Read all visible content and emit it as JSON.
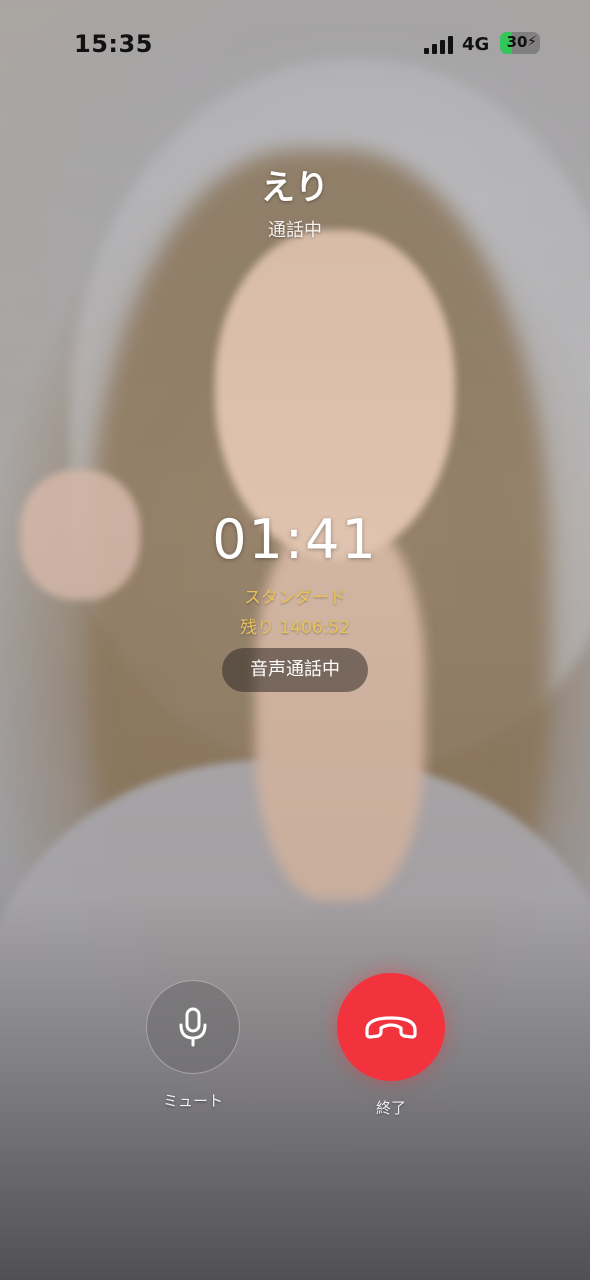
{
  "status_bar": {
    "time": "15:35",
    "network": "4G",
    "battery": "30",
    "battery_level": 0.3,
    "signal_icon": "signal-bars-icon",
    "charging_icon": "bolt-icon"
  },
  "caller": {
    "name": "えり",
    "status": "通話中"
  },
  "call": {
    "timer": "01:41",
    "plan": "スタンダード",
    "remaining": "残り 1406:52",
    "mode": "音声通話中"
  },
  "controls": {
    "mute_label": "ミュート",
    "mute_icon": "microphone-icon",
    "end_label": "終了",
    "end_icon": "hang-up-icon"
  },
  "colors": {
    "accent_gold": "#e8c35a",
    "end_red": "#f2333d",
    "battery_green": "#33c759"
  }
}
